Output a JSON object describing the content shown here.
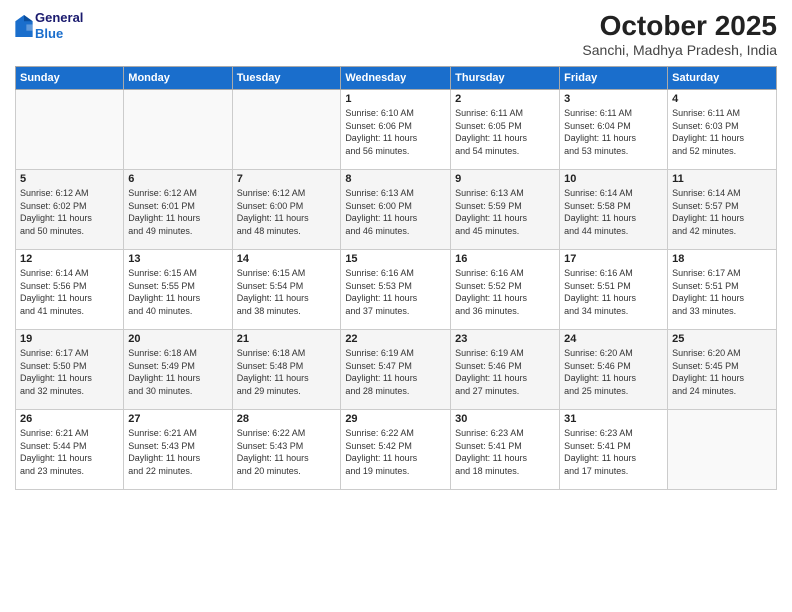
{
  "header": {
    "logo_line1": "General",
    "logo_line2": "Blue",
    "month_title": "October 2025",
    "location": "Sanchi, Madhya Pradesh, India"
  },
  "weekdays": [
    "Sunday",
    "Monday",
    "Tuesday",
    "Wednesday",
    "Thursday",
    "Friday",
    "Saturday"
  ],
  "weeks": [
    [
      {
        "day": "",
        "info": ""
      },
      {
        "day": "",
        "info": ""
      },
      {
        "day": "",
        "info": ""
      },
      {
        "day": "1",
        "info": "Sunrise: 6:10 AM\nSunset: 6:06 PM\nDaylight: 11 hours\nand 56 minutes."
      },
      {
        "day": "2",
        "info": "Sunrise: 6:11 AM\nSunset: 6:05 PM\nDaylight: 11 hours\nand 54 minutes."
      },
      {
        "day": "3",
        "info": "Sunrise: 6:11 AM\nSunset: 6:04 PM\nDaylight: 11 hours\nand 53 minutes."
      },
      {
        "day": "4",
        "info": "Sunrise: 6:11 AM\nSunset: 6:03 PM\nDaylight: 11 hours\nand 52 minutes."
      }
    ],
    [
      {
        "day": "5",
        "info": "Sunrise: 6:12 AM\nSunset: 6:02 PM\nDaylight: 11 hours\nand 50 minutes."
      },
      {
        "day": "6",
        "info": "Sunrise: 6:12 AM\nSunset: 6:01 PM\nDaylight: 11 hours\nand 49 minutes."
      },
      {
        "day": "7",
        "info": "Sunrise: 6:12 AM\nSunset: 6:00 PM\nDaylight: 11 hours\nand 48 minutes."
      },
      {
        "day": "8",
        "info": "Sunrise: 6:13 AM\nSunset: 6:00 PM\nDaylight: 11 hours\nand 46 minutes."
      },
      {
        "day": "9",
        "info": "Sunrise: 6:13 AM\nSunset: 5:59 PM\nDaylight: 11 hours\nand 45 minutes."
      },
      {
        "day": "10",
        "info": "Sunrise: 6:14 AM\nSunset: 5:58 PM\nDaylight: 11 hours\nand 44 minutes."
      },
      {
        "day": "11",
        "info": "Sunrise: 6:14 AM\nSunset: 5:57 PM\nDaylight: 11 hours\nand 42 minutes."
      }
    ],
    [
      {
        "day": "12",
        "info": "Sunrise: 6:14 AM\nSunset: 5:56 PM\nDaylight: 11 hours\nand 41 minutes."
      },
      {
        "day": "13",
        "info": "Sunrise: 6:15 AM\nSunset: 5:55 PM\nDaylight: 11 hours\nand 40 minutes."
      },
      {
        "day": "14",
        "info": "Sunrise: 6:15 AM\nSunset: 5:54 PM\nDaylight: 11 hours\nand 38 minutes."
      },
      {
        "day": "15",
        "info": "Sunrise: 6:16 AM\nSunset: 5:53 PM\nDaylight: 11 hours\nand 37 minutes."
      },
      {
        "day": "16",
        "info": "Sunrise: 6:16 AM\nSunset: 5:52 PM\nDaylight: 11 hours\nand 36 minutes."
      },
      {
        "day": "17",
        "info": "Sunrise: 6:16 AM\nSunset: 5:51 PM\nDaylight: 11 hours\nand 34 minutes."
      },
      {
        "day": "18",
        "info": "Sunrise: 6:17 AM\nSunset: 5:51 PM\nDaylight: 11 hours\nand 33 minutes."
      }
    ],
    [
      {
        "day": "19",
        "info": "Sunrise: 6:17 AM\nSunset: 5:50 PM\nDaylight: 11 hours\nand 32 minutes."
      },
      {
        "day": "20",
        "info": "Sunrise: 6:18 AM\nSunset: 5:49 PM\nDaylight: 11 hours\nand 30 minutes."
      },
      {
        "day": "21",
        "info": "Sunrise: 6:18 AM\nSunset: 5:48 PM\nDaylight: 11 hours\nand 29 minutes."
      },
      {
        "day": "22",
        "info": "Sunrise: 6:19 AM\nSunset: 5:47 PM\nDaylight: 11 hours\nand 28 minutes."
      },
      {
        "day": "23",
        "info": "Sunrise: 6:19 AM\nSunset: 5:46 PM\nDaylight: 11 hours\nand 27 minutes."
      },
      {
        "day": "24",
        "info": "Sunrise: 6:20 AM\nSunset: 5:46 PM\nDaylight: 11 hours\nand 25 minutes."
      },
      {
        "day": "25",
        "info": "Sunrise: 6:20 AM\nSunset: 5:45 PM\nDaylight: 11 hours\nand 24 minutes."
      }
    ],
    [
      {
        "day": "26",
        "info": "Sunrise: 6:21 AM\nSunset: 5:44 PM\nDaylight: 11 hours\nand 23 minutes."
      },
      {
        "day": "27",
        "info": "Sunrise: 6:21 AM\nSunset: 5:43 PM\nDaylight: 11 hours\nand 22 minutes."
      },
      {
        "day": "28",
        "info": "Sunrise: 6:22 AM\nSunset: 5:43 PM\nDaylight: 11 hours\nand 20 minutes."
      },
      {
        "day": "29",
        "info": "Sunrise: 6:22 AM\nSunset: 5:42 PM\nDaylight: 11 hours\nand 19 minutes."
      },
      {
        "day": "30",
        "info": "Sunrise: 6:23 AM\nSunset: 5:41 PM\nDaylight: 11 hours\nand 18 minutes."
      },
      {
        "day": "31",
        "info": "Sunrise: 6:23 AM\nSunset: 5:41 PM\nDaylight: 11 hours\nand 17 minutes."
      },
      {
        "day": "",
        "info": ""
      }
    ]
  ]
}
